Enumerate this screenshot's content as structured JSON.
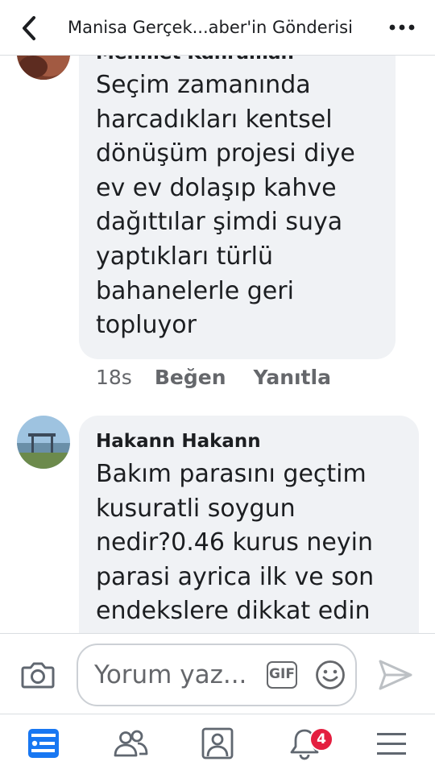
{
  "header": {
    "title": "Manisa Gerçek...aber'in Gönderisi",
    "back_icon": "chevron-left-icon",
    "more_icon": "more-dots-icon"
  },
  "comments": [
    {
      "author": "Mehmet Kahraman",
      "lines": [
        "Seçim zamanında",
        "harcadıkları kentsel",
        "dönüşüm projesi diye",
        "ev ev dolaşıp kahve",
        "dağıttılar şimdi suya",
        "yaptıkları türlü",
        "bahanelerle geri",
        "topluyor"
      ],
      "time": "18s",
      "like_label": "Beğen",
      "reply_label": "Yanıtla"
    },
    {
      "author": "Hakann Hakann",
      "lines": [
        "Bakım parasını geçtim",
        "kusuratli soygun",
        "nedir?0.46 kurus neyin",
        "parasi ayrica ilk ve son",
        "endekslere dikkat edin"
      ]
    }
  ],
  "composer": {
    "placeholder": "Yorum yaz...",
    "gif_label": "GIF"
  },
  "tabbar": {
    "items": [
      "news-feed-icon",
      "friends-icon",
      "profile-icon",
      "notifications-icon",
      "menu-icon"
    ],
    "notification_count": "4"
  },
  "colors": {
    "accent": "#1877f2",
    "bubble": "#f0f2f5",
    "badge": "#e41e3f",
    "muted": "#65676b"
  }
}
